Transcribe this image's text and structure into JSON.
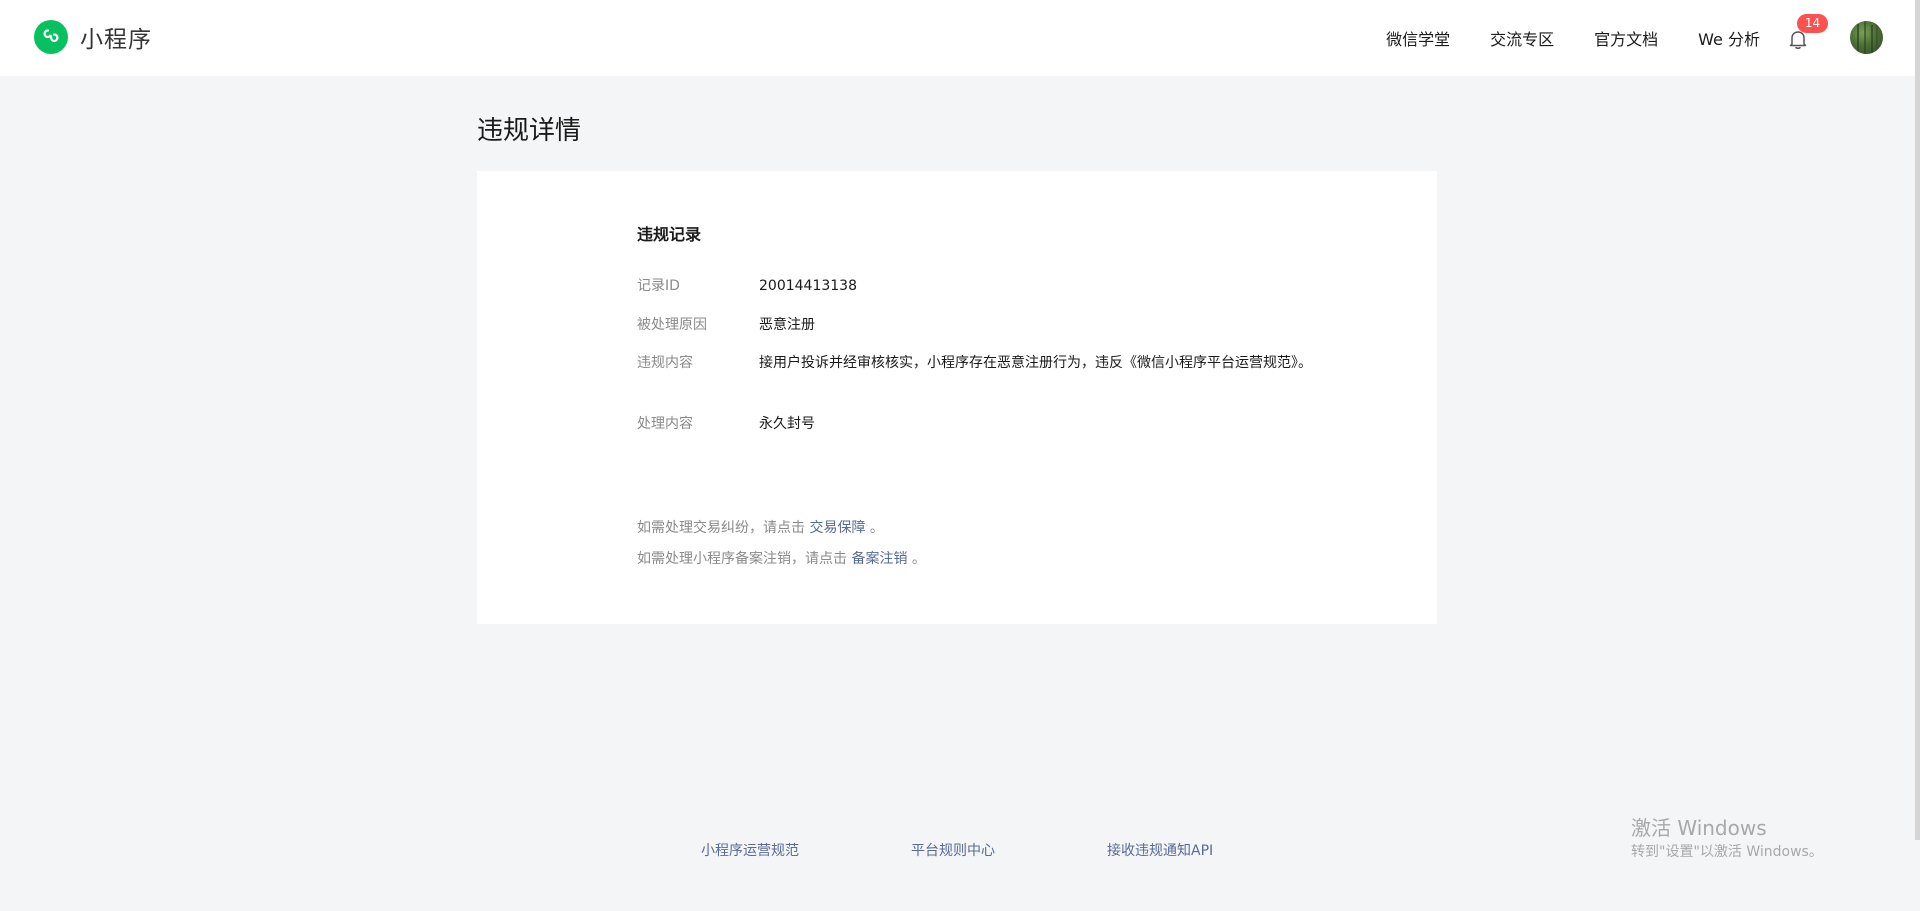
{
  "header": {
    "logo_text": "小程序",
    "nav": [
      "微信学堂",
      "交流专区",
      "官方文档",
      "We 分析"
    ],
    "notification_count": "14"
  },
  "page": {
    "title": "违规详情"
  },
  "record": {
    "section_title": "违规记录",
    "fields": [
      {
        "label": "记录ID",
        "value": "20014413138"
      },
      {
        "label": "被处理原因",
        "value": "恶意注册"
      },
      {
        "label": "违规内容",
        "value": "接用户投诉并经审核核实，小程序存在恶意注册行为，违反《微信小程序平台运营规范》。"
      },
      {
        "label": "处理内容",
        "value": "永久封号"
      }
    ]
  },
  "notes": [
    {
      "prefix": "如需处理交易纠纷，请点击 ",
      "link": "交易保障",
      "suffix": " 。"
    },
    {
      "prefix": "如需处理小程序备案注销，请点击 ",
      "link": "备案注销",
      "suffix": " 。"
    }
  ],
  "footer": {
    "links": [
      "小程序运营规范",
      "平台规则中心",
      "接收违规通知API"
    ]
  },
  "watermark": {
    "title": "激活 Windows",
    "subtitle": "转到\"设置\"以激活 Windows。"
  },
  "colors": {
    "brand_green": "#07c160",
    "link": "#576b95",
    "badge_red": "#fa5151",
    "page_bg": "#f4f5f7"
  }
}
